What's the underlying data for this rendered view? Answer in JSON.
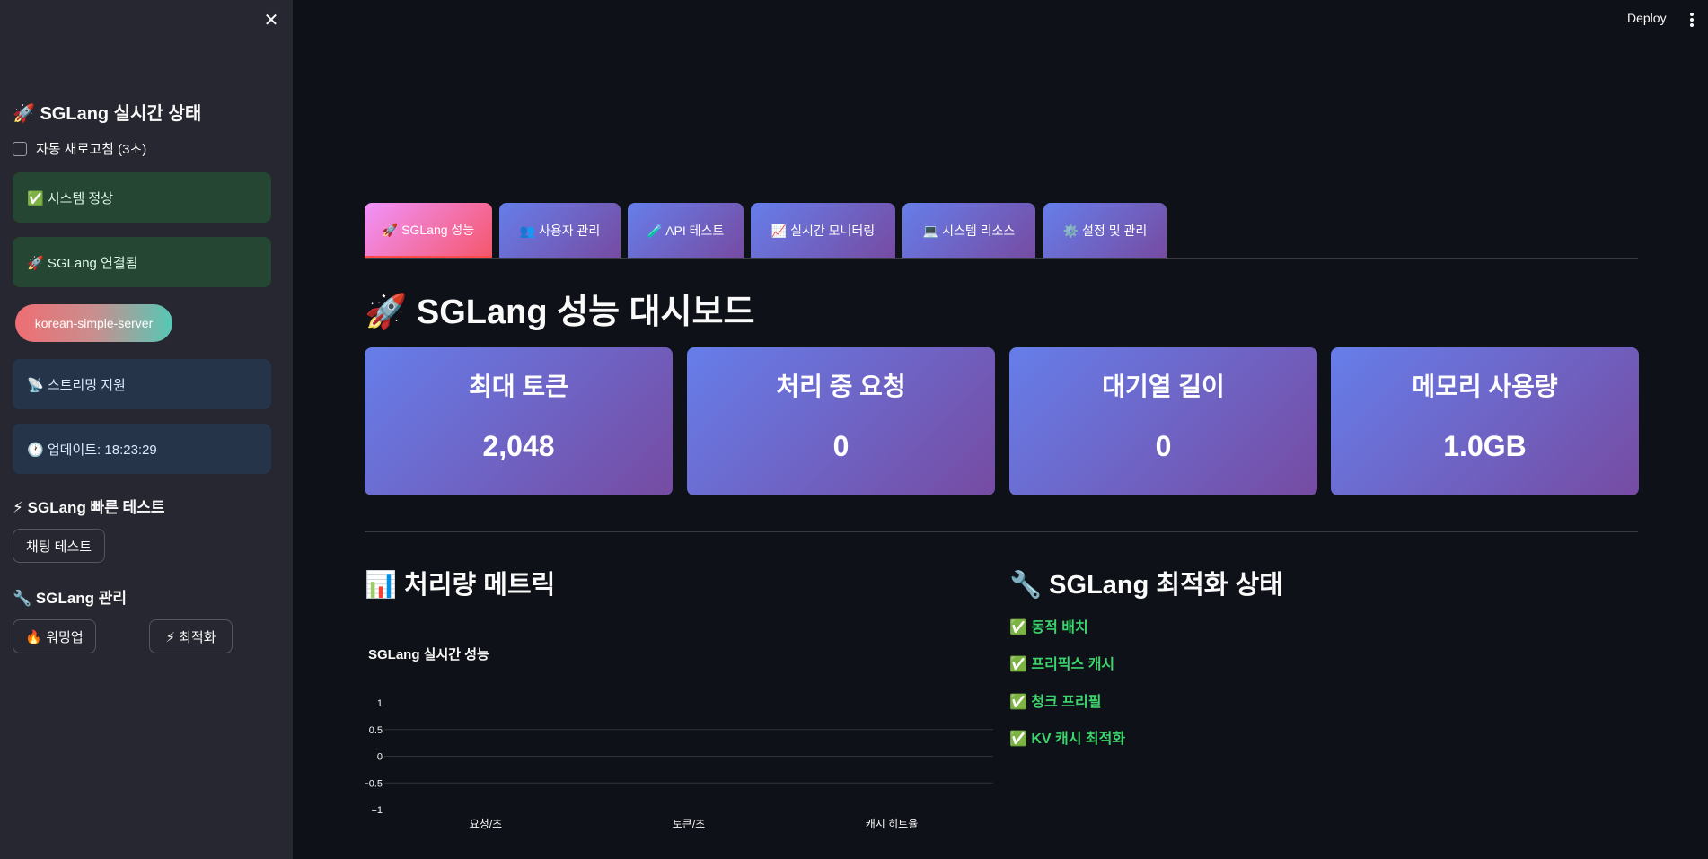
{
  "sidebar": {
    "close_icon": "close-icon",
    "realtime_title": "🚀 SGLang 실시간 상태",
    "auto_refresh_label": "자동 새로고침 (3초)",
    "auto_refresh_checked": false,
    "status_system": "✅ 시스템 정상",
    "status_connection": "🚀 SGLang 연결됨",
    "server_name": "korean-simple-server",
    "status_streaming": "📡 스트리밍 지원",
    "status_updated": "🕐 업데이트: 18:23:29",
    "quick_test_title": "⚡ SGLang 빠른 테스트",
    "chat_test_button": "채팅 테스트",
    "manage_title": "🔧 SGLang 관리",
    "warmup_button": "🔥 워밍업",
    "optimize_button": "⚡ 최적화"
  },
  "header": {
    "deploy_label": "Deploy",
    "menu_icon": "kebab-menu-icon"
  },
  "tabs": [
    {
      "label": "🚀 SGLang 성능",
      "active": true
    },
    {
      "label": "👥 사용자 관리",
      "active": false
    },
    {
      "label": "🧪 API 테스트",
      "active": false
    },
    {
      "label": "📈 실시간 모니터링",
      "active": false
    },
    {
      "label": "💻 시스템 리소스",
      "active": false
    },
    {
      "label": "⚙️ 설정 및 관리",
      "active": false
    }
  ],
  "main": {
    "title": "🚀 SGLang 성능 대시보드",
    "metrics": [
      {
        "label": "최대 토큰",
        "value": "2,048"
      },
      {
        "label": "처리 중 요청",
        "value": "0"
      },
      {
        "label": "대기열 길이",
        "value": "0"
      },
      {
        "label": "메모리 사용량",
        "value": "1.0GB"
      }
    ],
    "throughput_title": "📊 처리량 메트릭",
    "optimization_title": "🔧 SGLang 최적화 상태",
    "optimizations": [
      "✅ 동적 배치",
      "✅ 프리픽스 캐시",
      "✅ 청크 프리필",
      "✅ KV 캐시 최적화"
    ]
  },
  "colors": {
    "background": "#0e1117",
    "sidebar": "#262730",
    "card_gradient_start": "#667eea",
    "card_gradient_end": "#764ba2",
    "active_tab_start": "#f093fb",
    "active_tab_end": "#f5576c",
    "success_text": "#3dd56d"
  },
  "chart_data": {
    "type": "bar",
    "title": "SGLang 실시간 성능",
    "categories": [
      "요청/초",
      "토큰/초",
      "캐시 히트율"
    ],
    "values": [
      0,
      0,
      0
    ],
    "yticks": [
      "1",
      "0.5",
      "0",
      "−0.5",
      "−1"
    ],
    "ylim": [
      -1,
      1
    ],
    "grid": true
  }
}
